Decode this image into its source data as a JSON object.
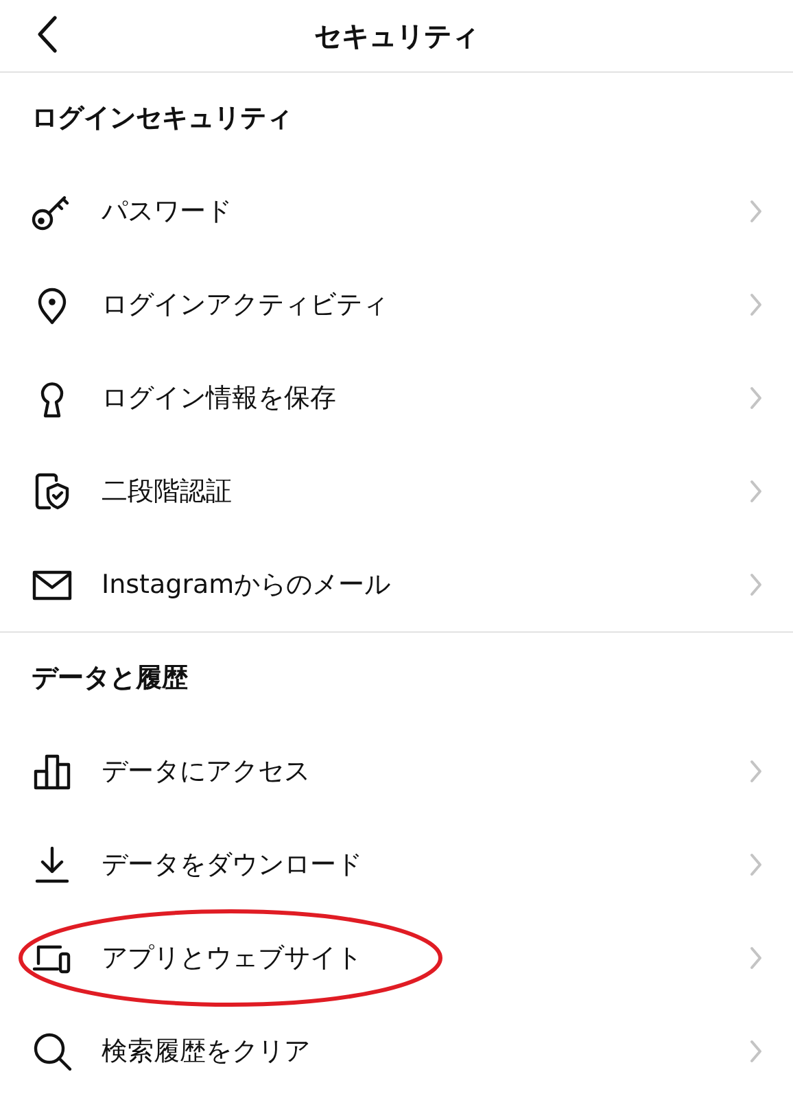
{
  "header": {
    "title": "セキュリティ"
  },
  "sections": [
    {
      "title": "ログインセキュリティ",
      "items": [
        {
          "label": "パスワード",
          "highlighted": false
        },
        {
          "label": "ログインアクティビティ",
          "highlighted": false
        },
        {
          "label": "ログイン情報を保存",
          "highlighted": false
        },
        {
          "label": "二段階認証",
          "highlighted": false
        },
        {
          "label": "Instagramからのメール",
          "highlighted": false
        }
      ]
    },
    {
      "title": "データと履歴",
      "items": [
        {
          "label": "データにアクセス",
          "highlighted": false
        },
        {
          "label": "データをダウンロード",
          "highlighted": false
        },
        {
          "label": "アプリとウェブサイト",
          "highlighted": true
        },
        {
          "label": "検索履歴をクリア",
          "highlighted": false
        }
      ]
    }
  ]
}
